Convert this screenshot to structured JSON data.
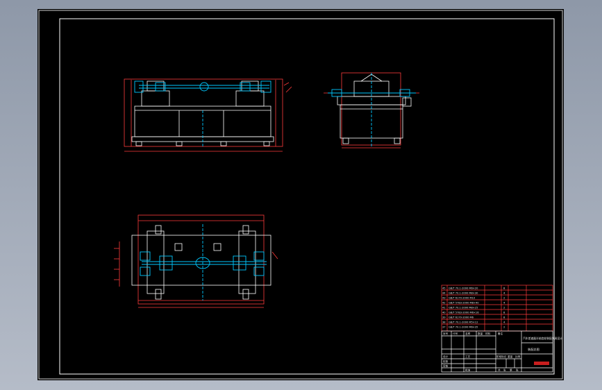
{
  "drawing": {
    "title_block": {
      "parts_rows": [
        {
          "no": "45",
          "name": "GB/T 70.1-2000 M6×20",
          "qty": "8",
          "material": "",
          "note": ""
        },
        {
          "no": "44",
          "name": "GB/T 70.1-2000 M8×30",
          "qty": "4",
          "material": "",
          "note": ""
        },
        {
          "no": "43",
          "name": "GB/T 6170-2000 M10",
          "qty": "2",
          "material": "",
          "note": ""
        },
        {
          "no": "42",
          "name": "GB/T 5783-2000 M8×40",
          "qty": "4",
          "material": "",
          "note": ""
        },
        {
          "no": "41",
          "name": "GB/T 70.1-2000 M8×25",
          "qty": "2",
          "material": "",
          "note": ""
        },
        {
          "no": "40",
          "name": "GB/T 5783-2000 M6×16",
          "qty": "8",
          "material": "",
          "note": ""
        },
        {
          "no": "39",
          "name": "GB/T 6170-2000 M6",
          "qty": "8",
          "material": "",
          "note": ""
        },
        {
          "no": "38",
          "name": "GB/T 70.1-2000 M5×12",
          "qty": "4",
          "material": "",
          "note": ""
        },
        {
          "no": "37",
          "name": "GB/T 70.1-2000 M6×35",
          "qty": "2",
          "material": "",
          "note": ""
        }
      ],
      "header_cells": [
        "序号",
        "代号",
        "名称",
        "数量",
        "材料",
        "备注"
      ],
      "drawing_title": "汽车差速器半轴齿轮装配夹具设计",
      "drawing_name": "装配总图",
      "company_label": "",
      "sign_labels": [
        "设计",
        "校核",
        "审核",
        "工艺",
        "批准"
      ],
      "stage_labels": [
        "阶段标记",
        "重量",
        "比例"
      ],
      "footer_labels": [
        "共",
        "张",
        "第",
        "张"
      ]
    },
    "annotations": {
      "colors": {
        "sheet": "#000000",
        "border": "#ffffff",
        "dimension": "#ff3b3b",
        "centerline": "#00c8ff",
        "outline": "#ffffff"
      }
    }
  }
}
